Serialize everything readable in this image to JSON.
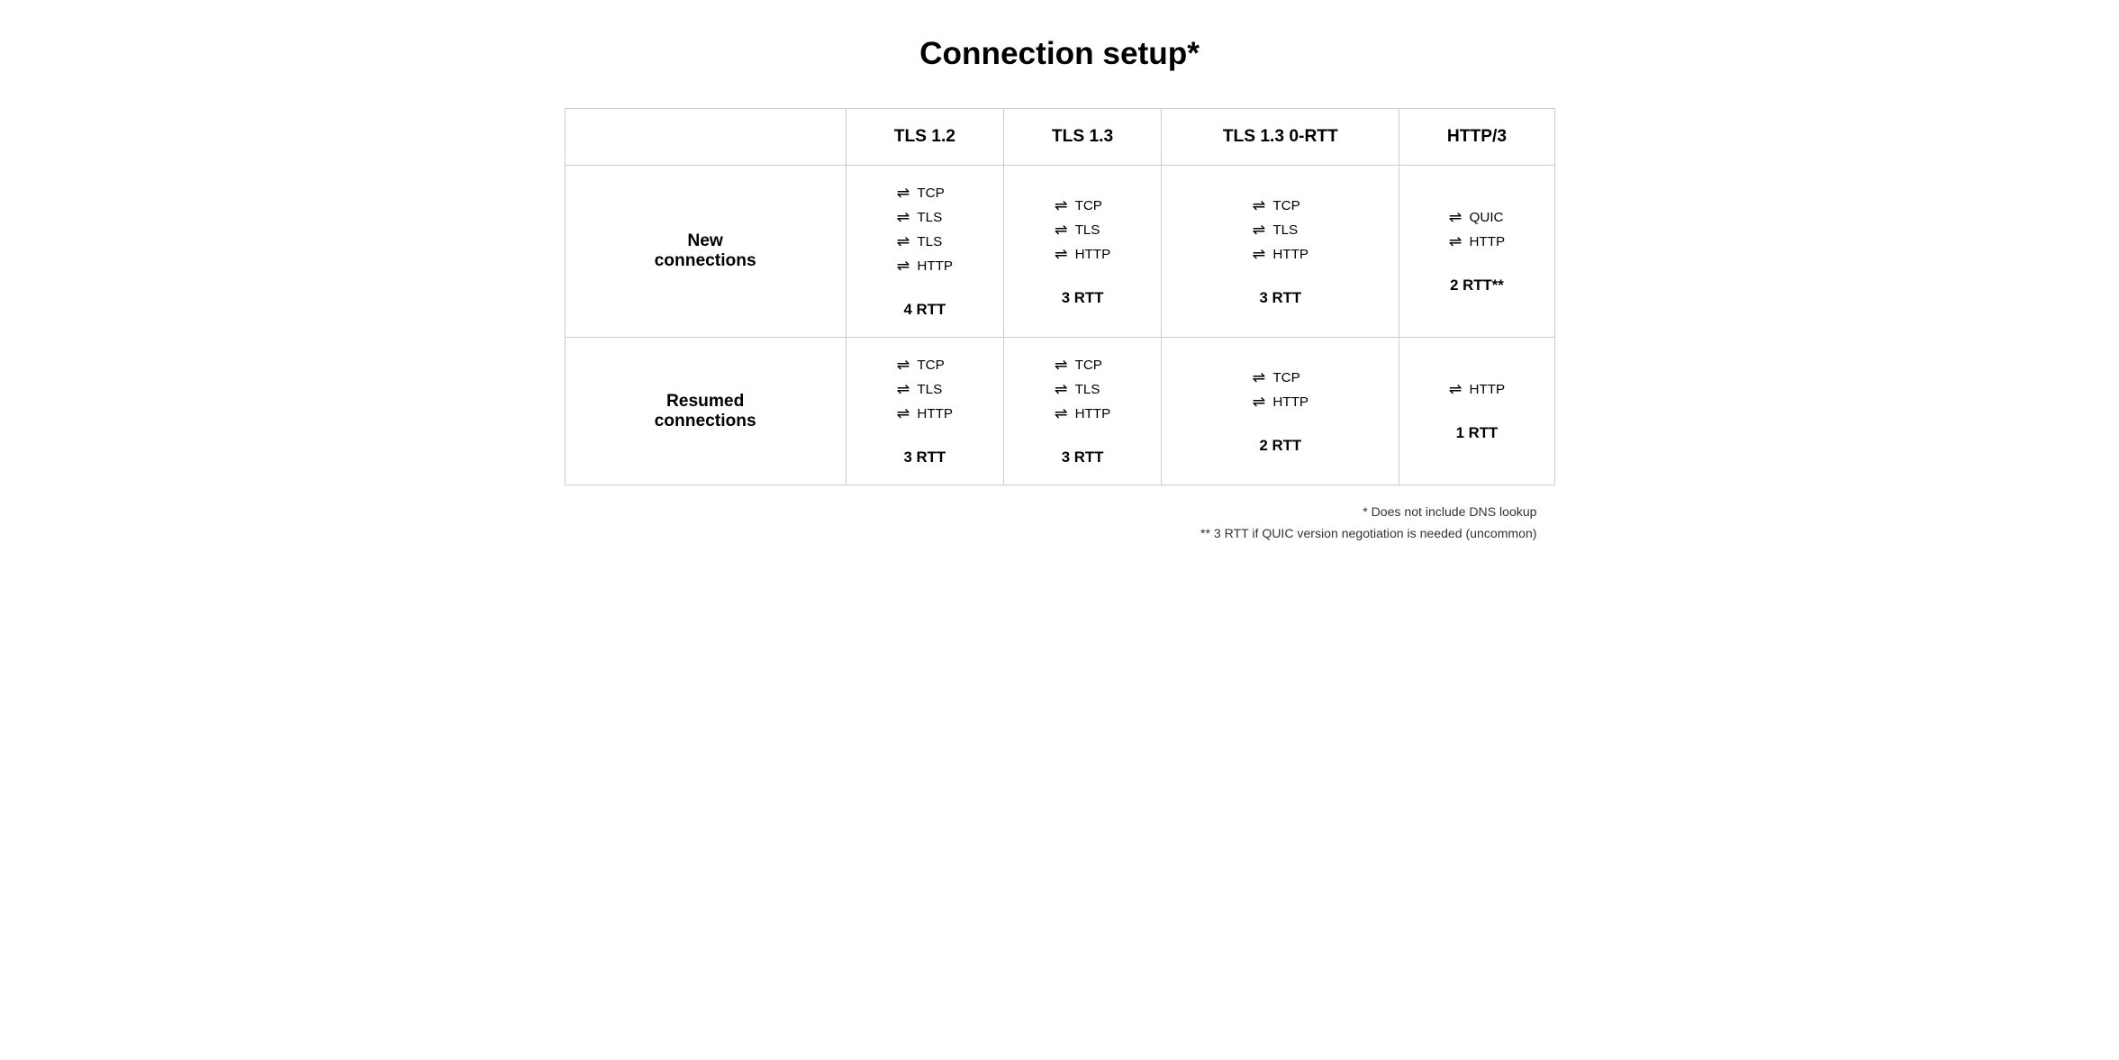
{
  "title": "Connection setup*",
  "columns": [
    "",
    "TLS 1.2",
    "TLS 1.3",
    "TLS 1.3 0-RTT",
    "HTTP/3"
  ],
  "rows": [
    {
      "label": "New\nconnections",
      "cells": [
        {
          "steps": [
            "TCP",
            "TLS",
            "TLS",
            "HTTP"
          ],
          "rtt": "4 RTT"
        },
        {
          "steps": [
            "TCP",
            "TLS",
            "HTTP"
          ],
          "rtt": "3 RTT"
        },
        {
          "steps": [
            "TCP",
            "TLS",
            "HTTP"
          ],
          "rtt": "3 RTT"
        },
        {
          "steps": [
            "QUIC",
            "HTTP"
          ],
          "rtt": "2 RTT**"
        }
      ]
    },
    {
      "label": "Resumed\nconnections",
      "cells": [
        {
          "steps": [
            "TCP",
            "TLS",
            "HTTP"
          ],
          "rtt": "3 RTT"
        },
        {
          "steps": [
            "TCP",
            "TLS",
            "HTTP"
          ],
          "rtt": "3 RTT"
        },
        {
          "steps": [
            "TCP",
            "HTTP"
          ],
          "rtt": "2 RTT"
        },
        {
          "steps": [
            "HTTP"
          ],
          "rtt": "1 RTT"
        }
      ]
    }
  ],
  "footnotes": [
    "* Does not include DNS lookup",
    "** 3 RTT if QUIC version negotiation is needed (uncommon)"
  ]
}
